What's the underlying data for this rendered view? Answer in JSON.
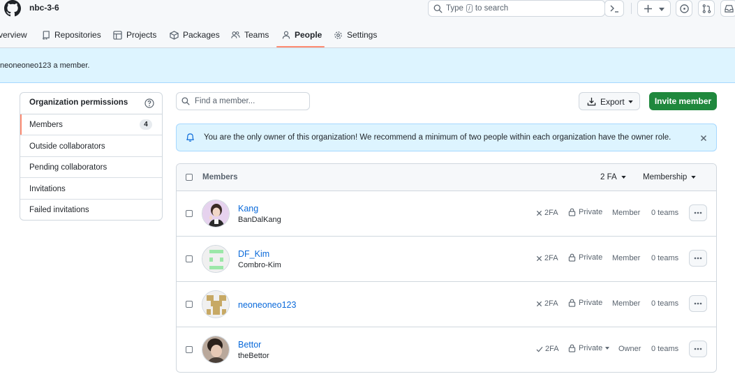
{
  "header": {
    "org_name": "nbc-3-6",
    "search_prefix": "Type",
    "search_key": "/",
    "search_suffix": "to search"
  },
  "tabs": [
    {
      "label": "verview",
      "icon": "book-icon"
    },
    {
      "label": "Repositories",
      "icon": "repo-icon"
    },
    {
      "label": "Projects",
      "icon": "table-icon"
    },
    {
      "label": "Packages",
      "icon": "package-icon"
    },
    {
      "label": "Teams",
      "icon": "people-icon"
    },
    {
      "label": "People",
      "icon": "person-icon",
      "active": true
    },
    {
      "label": "Settings",
      "icon": "gear-icon"
    }
  ],
  "flash": {
    "message": "neoneoneo123 a member."
  },
  "sidebar": {
    "heading": "Organization permissions",
    "items": [
      {
        "label": "Members",
        "count": "4",
        "active": true
      },
      {
        "label": "Outside collaborators"
      },
      {
        "label": "Pending collaborators"
      },
      {
        "label": "Invitations"
      },
      {
        "label": "Failed invitations"
      }
    ]
  },
  "toolbar": {
    "find_placeholder": "Find a member...",
    "export_label": "Export",
    "invite_label": "Invite member"
  },
  "notice": {
    "text": "You are the only owner of this organization! We recommend a minimum of two people within each organization have the owner role."
  },
  "members": {
    "header_label": "Members",
    "filter_2fa": "2 FA",
    "filter_membership": "Membership",
    "rows": [
      {
        "name": "Kang",
        "login": "BanDalKang",
        "twofa": "2FA",
        "twofa_enabled": false,
        "visibility": "Private",
        "role": "Member",
        "teams": "0 teams",
        "avatar": "photo-avatar"
      },
      {
        "name": "DF_Kim",
        "login": "Combro-Kim",
        "twofa": "2FA",
        "twofa_enabled": false,
        "visibility": "Private",
        "role": "Member",
        "teams": "0 teams",
        "avatar": "identicon-green"
      },
      {
        "name": "neoneoneo123",
        "login": "",
        "twofa": "2FA",
        "twofa_enabled": false,
        "visibility": "Private",
        "role": "Member",
        "teams": "0 teams",
        "avatar": "identicon-tan"
      },
      {
        "name": "Bettor",
        "login": "theBettor",
        "twofa": "2FA",
        "twofa_enabled": true,
        "visibility": "Private",
        "role": "Owner",
        "teams": "0 teams",
        "avatar": "photo-avatar"
      }
    ]
  },
  "colors": {
    "accent_green": "#1f883d",
    "link_blue": "#0969da",
    "tab_underline": "#fd8c73",
    "flash_bg": "#ddf4ff",
    "identicon_green": "#9be7a8",
    "identicon_tan": "#c7a965"
  }
}
